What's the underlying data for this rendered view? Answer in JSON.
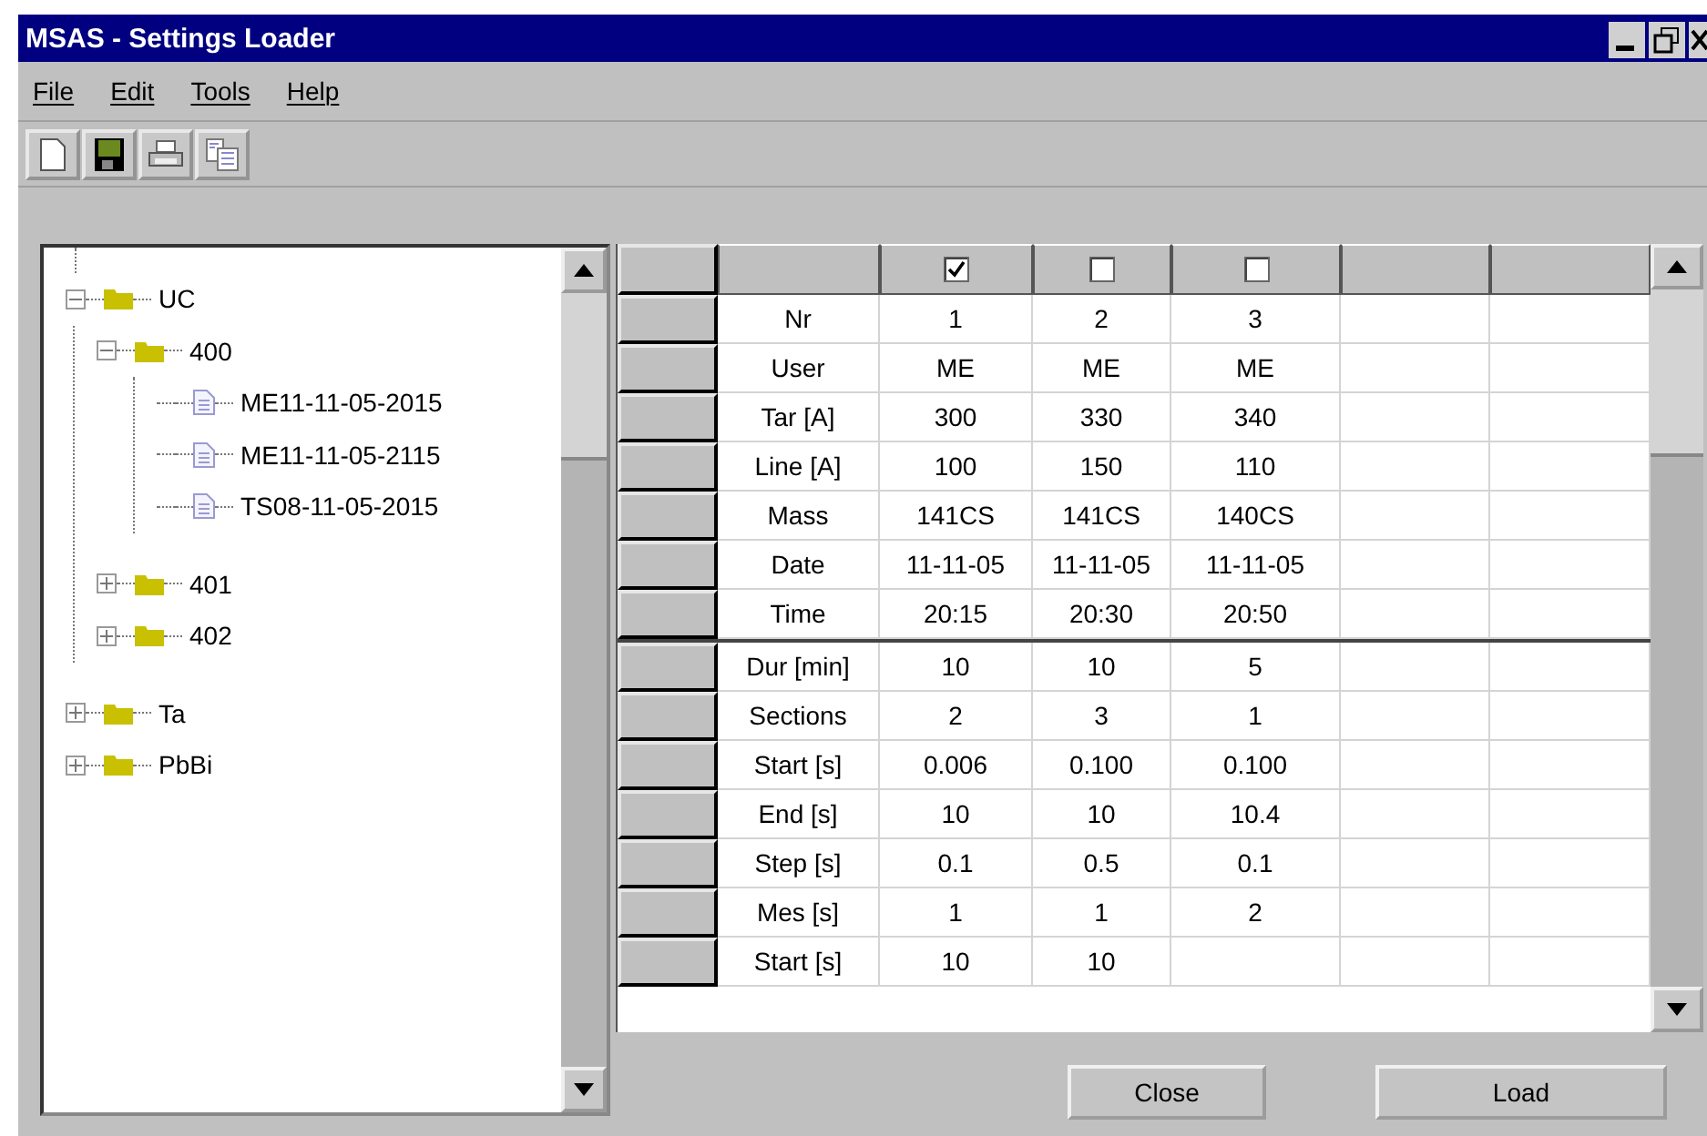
{
  "window": {
    "title": "MSAS - Settings Loader"
  },
  "menu": [
    "File",
    "Edit",
    "Tools",
    "Help"
  ],
  "tree": {
    "items": [
      {
        "label": "UC",
        "kind": "folder",
        "expanded": true,
        "children": [
          {
            "label": "400",
            "kind": "folder",
            "expanded": true,
            "children": [
              {
                "label": "ME11-11-05-2015",
                "kind": "file"
              },
              {
                "label": "ME11-11-05-2115",
                "kind": "file"
              },
              {
                "label": "TS08-11-05-2015",
                "kind": "file"
              }
            ]
          },
          {
            "label": "401",
            "kind": "folder",
            "expanded": false
          },
          {
            "label": "402",
            "kind": "folder",
            "expanded": false
          }
        ]
      },
      {
        "label": "Ta",
        "kind": "folder",
        "expanded": false
      },
      {
        "label": "PbBi",
        "kind": "folder",
        "expanded": false
      }
    ]
  },
  "table": {
    "columns": [
      {
        "kind": "checkbox",
        "checked": true
      },
      {
        "kind": "checkbox",
        "checked": false
      },
      {
        "kind": "checkbox",
        "checked": false
      },
      {
        "kind": "blank"
      },
      {
        "kind": "blank"
      }
    ],
    "groups": [
      [
        {
          "label": "Nr",
          "cells": [
            "1",
            "2",
            "3"
          ]
        },
        {
          "label": "User",
          "cells": [
            "ME",
            "ME",
            "ME"
          ]
        },
        {
          "label": "Tar [A]",
          "cells": [
            "300",
            "330",
            "340"
          ]
        },
        {
          "label": "Line [A]",
          "cells": [
            "100",
            "150",
            "110"
          ]
        },
        {
          "label": "Mass",
          "cells": [
            "141CS",
            "141CS",
            "140CS"
          ]
        },
        {
          "label": "Date",
          "cells": [
            "11-11-05",
            "11-11-05",
            "11-11-05"
          ]
        },
        {
          "label": "Time",
          "cells": [
            "20:15",
            "20:30",
            "20:50"
          ]
        }
      ],
      [
        {
          "label": "Dur [min]",
          "cells": [
            "10",
            "10",
            "5"
          ]
        },
        {
          "label": "Sections",
          "cells": [
            "2",
            "3",
            "1"
          ]
        },
        {
          "label": "Start [s]",
          "cells": [
            "0.006",
            "0.100",
            "0.100"
          ]
        },
        {
          "label": "End [s]",
          "cells": [
            "10",
            "10",
            "10.4"
          ]
        },
        {
          "label": "Step [s]",
          "cells": [
            "0.1",
            "0.5",
            "0.1"
          ]
        },
        {
          "label": "Mes [s]",
          "cells": [
            "1",
            "1",
            "2"
          ]
        },
        {
          "label": "Start [s]",
          "cells": [
            "10",
            "10"
          ]
        }
      ]
    ]
  },
  "buttons": [
    "Close",
    "Load"
  ]
}
